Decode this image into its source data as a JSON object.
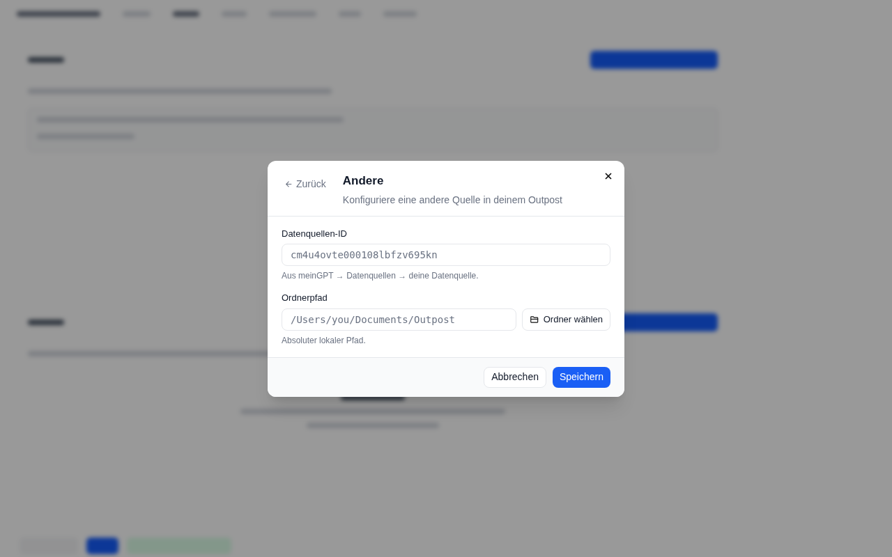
{
  "dialog": {
    "back": "Zurück",
    "title": "Andere",
    "subtitle": "Konfiguriere eine andere Quelle in deinem Outpost",
    "fields": [
      {
        "label": "Datenquellen-ID",
        "placeholder": "cm4u4ovte000108lbfzv695kn",
        "hint": "Aus meinGPT → Datenquellen → deine Datenquelle."
      },
      {
        "label": "Ordnerpfad",
        "placeholder": "/Users/you/Documents/Outpost",
        "button": "Ordner wählen",
        "hint": "Absoluter lokaler Pfad."
      }
    ],
    "cancel": "Abbrechen",
    "save": "Speichern"
  }
}
